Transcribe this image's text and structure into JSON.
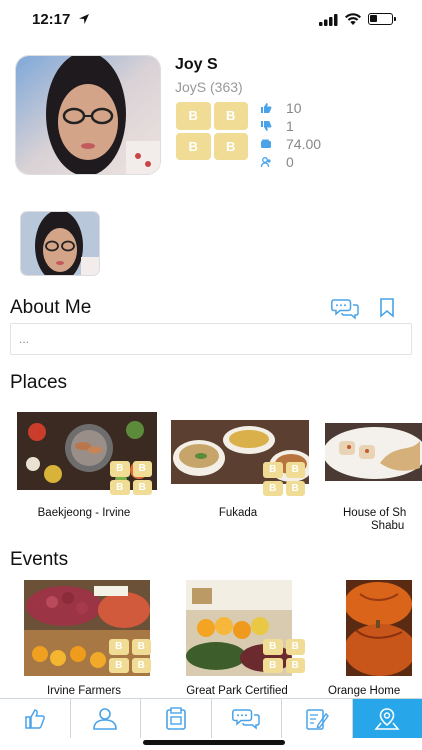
{
  "status_bar": {
    "time": "12:17"
  },
  "profile": {
    "name": "Joy S",
    "handle": "JoyS (363)",
    "badge_letters": [
      "B",
      "B",
      "B",
      "B"
    ],
    "stats": [
      {
        "icon": "thumbs-up-icon",
        "value": "10"
      },
      {
        "icon": "thumbs-down-icon",
        "value": "1"
      },
      {
        "icon": "wallet-icon",
        "value": "74.00"
      },
      {
        "icon": "users-icon",
        "value": "0"
      }
    ]
  },
  "about": {
    "title": "About Me",
    "text": "..."
  },
  "places": {
    "title": "Places",
    "items": [
      {
        "name": "Baekjeong - Irvine"
      },
      {
        "name": "Fukada"
      },
      {
        "name": "House of Sh",
        "name_line2": "Shabu"
      }
    ]
  },
  "events": {
    "title": "Events",
    "items": [
      {
        "name": "Irvine Farmers"
      },
      {
        "name": "Great Park Certified"
      },
      {
        "name": "Orange Home"
      }
    ]
  },
  "bottom_nav": {
    "items": [
      {
        "icon": "thumbs-up-icon",
        "active": false
      },
      {
        "icon": "person-icon",
        "active": false
      },
      {
        "icon": "document-icon",
        "active": false
      },
      {
        "icon": "chat-bubbles-icon",
        "active": false
      },
      {
        "icon": "edit-document-icon",
        "active": false
      },
      {
        "icon": "map-pin-icon",
        "active": true
      }
    ]
  },
  "colors": {
    "accent": "#27a6ea",
    "badge": "#f0dc94",
    "icon_blue": "#4aa3e8"
  }
}
